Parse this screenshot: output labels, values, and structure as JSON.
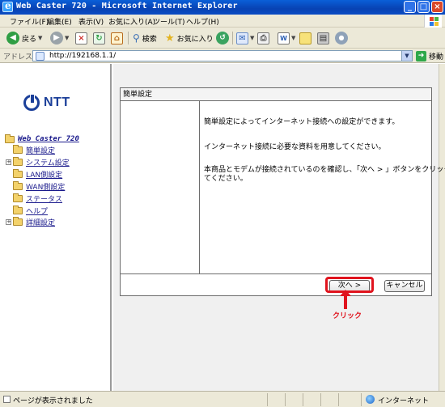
{
  "window": {
    "title": "Web Caster 720 - Microsoft Internet Explorer",
    "minimize": "_",
    "maximize": "□",
    "close": "×"
  },
  "menu": [
    "ファイル(F)",
    "編集(E)",
    "表示(V)",
    "お気に入り(A)",
    "ツール(T)",
    "ヘルプ(H)"
  ],
  "toolbar": {
    "back_label": "戻る",
    "search_label": "検索",
    "favorites_label": "お気に入り"
  },
  "address": {
    "label": "アドレス(D)",
    "url": "http://192168.1.1/",
    "go_label": "移動"
  },
  "sidebar": {
    "logo_text": "NTT",
    "root": "Web Caster 720",
    "items": [
      {
        "label": "簡単設定",
        "expandable": false
      },
      {
        "label": "システム設定",
        "expandable": true
      },
      {
        "label": "LAN側設定",
        "expandable": false
      },
      {
        "label": "WAN側設定",
        "expandable": false
      },
      {
        "label": "ステータス",
        "expandable": false
      },
      {
        "label": "ヘルプ",
        "expandable": false
      },
      {
        "label": "詳細設定",
        "expandable": true
      }
    ]
  },
  "panel": {
    "header": "簡単設定",
    "line1": "簡単設定によってインターネット接続への設定ができます。",
    "line2": "インターネット接続に必要な資料を用意してください。",
    "line3a": "本商品とモデムが接続されているのを確認し、「次へ > 」ボタンをクリックし",
    "line3b": "てください。",
    "next_button": "次へ >",
    "cancel_button": "キャンセル"
  },
  "annotation": {
    "callout": "クリック",
    "color": "#e0141e"
  },
  "status": {
    "text": "ページが表示されました",
    "zone": "インターネット"
  }
}
